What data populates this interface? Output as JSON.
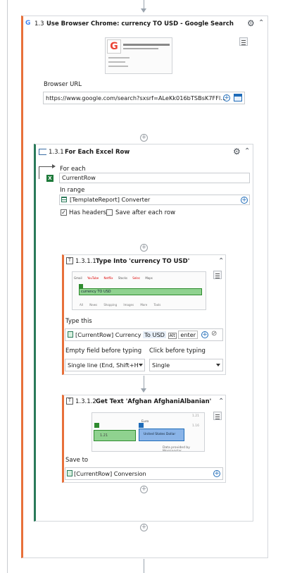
{
  "main_activity": {
    "number": "1.3",
    "title": "Use Browser Chrome: currency TO USD - Google Search",
    "url_label": "Browser URL",
    "url_value": "https://www.google.com/search?sxsrf=ALeKk016bTSBsK7FFl..."
  },
  "for_each": {
    "number": "1.3.1",
    "title": "For Each Excel Row",
    "for_each_label": "For each",
    "for_each_value": "CurrentRow",
    "in_range_label": "In range",
    "in_range_value": "[TemplateReport] Converter",
    "has_headers_label": "Has headers",
    "has_headers_checked": true,
    "save_after_label": "Save after each row",
    "save_after_checked": false
  },
  "type_into": {
    "number": "1.3.1.1",
    "title": "Type Into 'currency TO USD'",
    "type_this_label": "Type this",
    "type_this_value": "[CurrentRow] Currency",
    "type_this_suffix": "To USD",
    "type_this_key1": "Alt",
    "type_this_key2": "enter",
    "empty_field_label": "Empty field before typing",
    "empty_field_value": "Single line (End, Shift+H",
    "click_before_label": "Click before typing",
    "click_before_value": "Single",
    "preview": {
      "tabs": [
        "Gmail",
        "YouTube",
        "Netflix",
        "Stocks",
        "Selec",
        "Maps"
      ],
      "search_text": "currency TO USD",
      "bottom_links": [
        "All",
        "News",
        "Shopping",
        "Images",
        "More",
        "Tools"
      ]
    }
  },
  "get_text": {
    "number": "1.3.1.2",
    "title": "Get Text 'Afghan AfghaniAlbanian'",
    "save_to_label": "Save to",
    "save_to_value": "[CurrentRow] Conversion",
    "preview": {
      "value_left": "1.21",
      "currency_top": "Euro",
      "currency_bottom": "United States Dollar",
      "tick1": "1.21",
      "tick2": "1.16",
      "footer": "Data provided by Morningstar"
    }
  }
}
